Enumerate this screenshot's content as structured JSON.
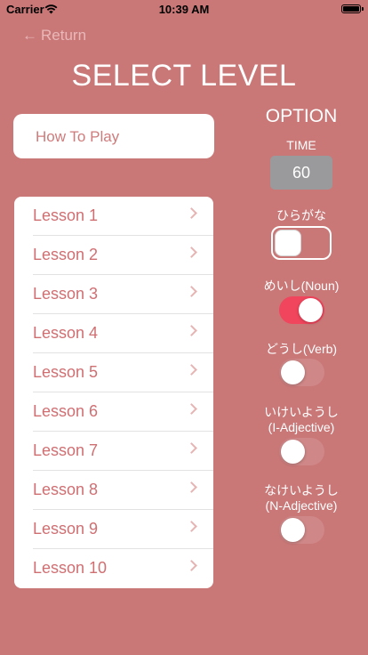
{
  "status": {
    "carrier": "Carrier",
    "time": "10:39 AM"
  },
  "nav": {
    "return_label": "Return"
  },
  "page": {
    "title": "SELECT LEVEL"
  },
  "how_to_play": {
    "label": "How To Play"
  },
  "lessons": [
    {
      "label": "Lesson 1"
    },
    {
      "label": "Lesson 2"
    },
    {
      "label": "Lesson 3"
    },
    {
      "label": "Lesson 4"
    },
    {
      "label": "Lesson 5"
    },
    {
      "label": "Lesson 6"
    },
    {
      "label": "Lesson 7"
    },
    {
      "label": "Lesson 8"
    },
    {
      "label": "Lesson 9"
    },
    {
      "label": "Lesson 10"
    }
  ],
  "options": {
    "title": "OPTION",
    "time_label": "TIME",
    "time_value": "60",
    "hiragana": {
      "label": "ひらがな",
      "on": false
    },
    "noun": {
      "label": "めいし(Noun)",
      "on": true
    },
    "verb": {
      "label": "どうし(Verb)",
      "on": false
    },
    "i_adjective": {
      "label_line1": "いけいようし",
      "label_line2": "(I-Adjective)",
      "on": false
    },
    "n_adjective": {
      "label_line1": "なけいようし",
      "label_line2": "(N-Adjective)",
      "on": false
    }
  },
  "colors": {
    "background": "#c97777",
    "accent_text": "#d06f72",
    "toggle_on": "#f0455c",
    "time_box": "#9a9a9d"
  },
  "icons": {
    "back": "left-arrow-icon",
    "row": "chevron-right-icon",
    "signal": "wifi-icon",
    "power": "battery-icon"
  }
}
